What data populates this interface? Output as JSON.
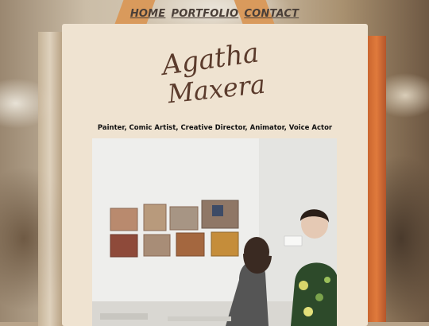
{
  "nav": {
    "home": "HOME",
    "portfolio": "PORTFOLIO",
    "contact": "CONTACT"
  },
  "logo": {
    "line1": "Agatha",
    "line2": "Maxera"
  },
  "tagline": "Painter, Comic Artist, Creative Director, Animator, Voice Actor",
  "colors": {
    "card": "#efe3d1",
    "nav_text": "#4a3f38",
    "logo": "#5b3b2c"
  }
}
